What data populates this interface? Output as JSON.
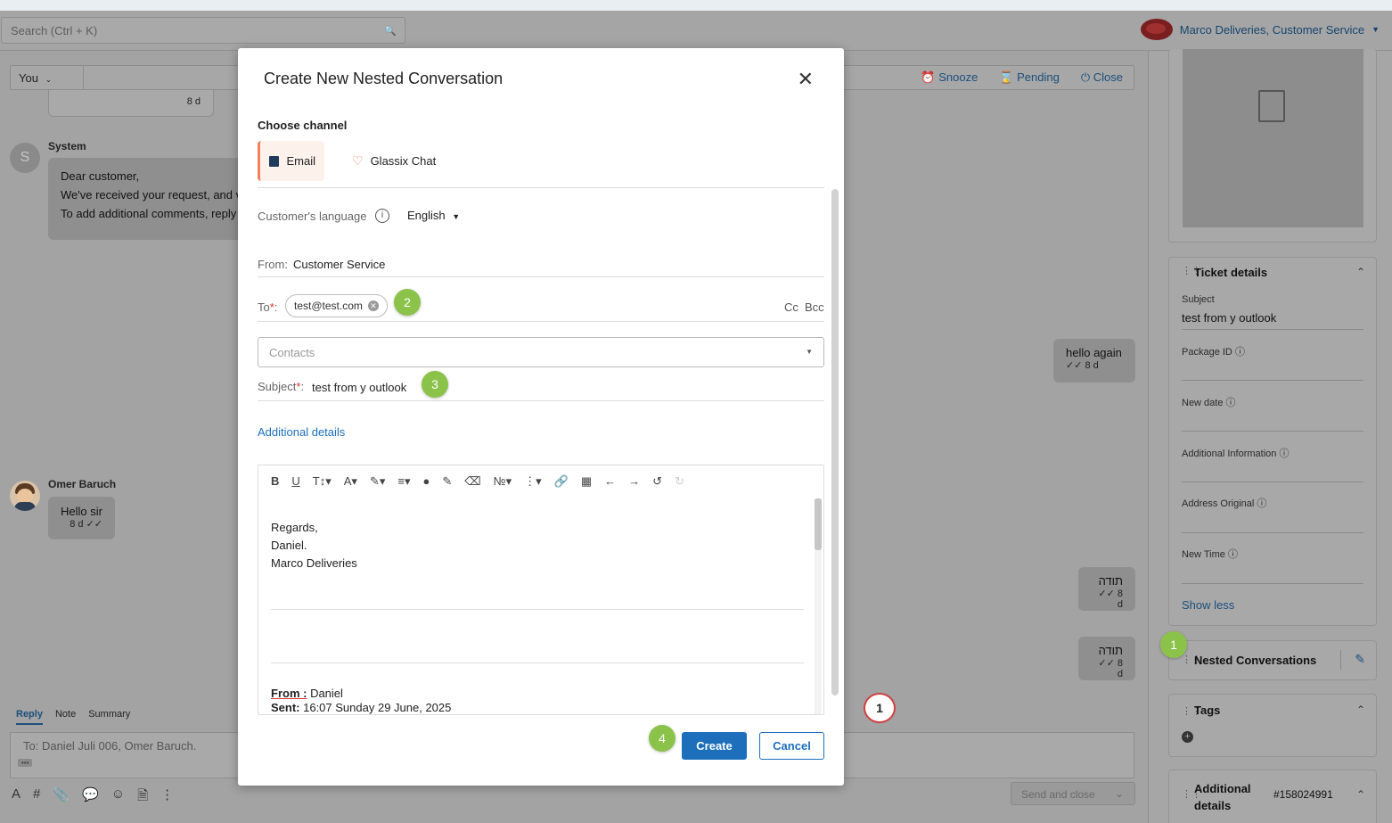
{
  "header": {
    "search_placeholder": "Search (Ctrl + K)",
    "brand_text": "Marco Deliveries, Customer Service",
    "brand_logo": "steak-logo"
  },
  "conversation": {
    "assignee": "You",
    "actions": [
      {
        "label": "Snooze",
        "icon": "alarm-icon"
      },
      {
        "label": "Pending",
        "icon": "hourglass-icon"
      },
      {
        "label": "Close",
        "icon": "power-icon"
      }
    ],
    "prev_bubble_time": "8 d",
    "system": {
      "name": "System",
      "initial": "S",
      "lines": [
        "Dear customer,",
        "We've received your request, and v",
        "To add additional comments, reply"
      ]
    },
    "hello_again": {
      "text": "hello again",
      "time": "8 d"
    },
    "omer": {
      "name": "Omer Baruch",
      "text": "Hello sir",
      "time": "8 d"
    },
    "toda1": {
      "text": "תודה",
      "time": "8 d"
    },
    "toda2": {
      "text": "תודה",
      "time": "8 d"
    },
    "reply_tabs": [
      "Reply",
      "Note",
      "Summary"
    ],
    "reply_to": "To: Daniel Juli 006, Omer Baruch.",
    "reply_more": "•••",
    "send_label": "Send and close"
  },
  "sidebar": {
    "ticket_details": {
      "title": "Ticket details",
      "fields": [
        {
          "label": "Subject",
          "value": "test from y outlook"
        },
        {
          "label": "Package ID",
          "value": ""
        },
        {
          "label": "New date",
          "value": ""
        },
        {
          "label": "Additional Information",
          "value": ""
        },
        {
          "label": "Address Original",
          "value": ""
        },
        {
          "label": "New Time",
          "value": ""
        }
      ],
      "show_less": "Show less"
    },
    "nested_title": "Nested Conversations",
    "tags_title": "Tags",
    "additional_title_1": "Additional",
    "additional_title_2": "details",
    "additional_id": "#158024991"
  },
  "modal": {
    "title": "Create New Nested Conversation",
    "choose_channel": "Choose channel",
    "channels": [
      "Email",
      "Glassix Chat"
    ],
    "language_label": "Customer's language",
    "language_value": "English",
    "from_label": "From:",
    "from_value": "Customer Service",
    "to_label": "To",
    "required_mark": "*",
    "to_colon": ":",
    "to_chip": "test@test.com",
    "cc": "Cc",
    "bcc": "Bcc",
    "contacts_placeholder": "Contacts",
    "subject_label": "Subject",
    "subject_value": "test from y outlook",
    "additional_details_link": "Additional details",
    "body_lines": [
      "Regards,",
      "Daniel.",
      "Marco Deliveries"
    ],
    "from_line_label": "From :",
    "from_line_value": " Daniel",
    "sent_line_label": "Sent:",
    "sent_line_value": " 16:07 Sunday 29 June, 2025",
    "create_label": "Create",
    "cancel_label": "Cancel"
  },
  "annotations": {
    "badge1": "1",
    "badge2": "2",
    "badge3": "3",
    "badge4": "4",
    "cursor": "1"
  },
  "colors": {
    "accent": "#1d6fbc",
    "badge": "#8bc34a",
    "email_tab": "#f0815a"
  }
}
